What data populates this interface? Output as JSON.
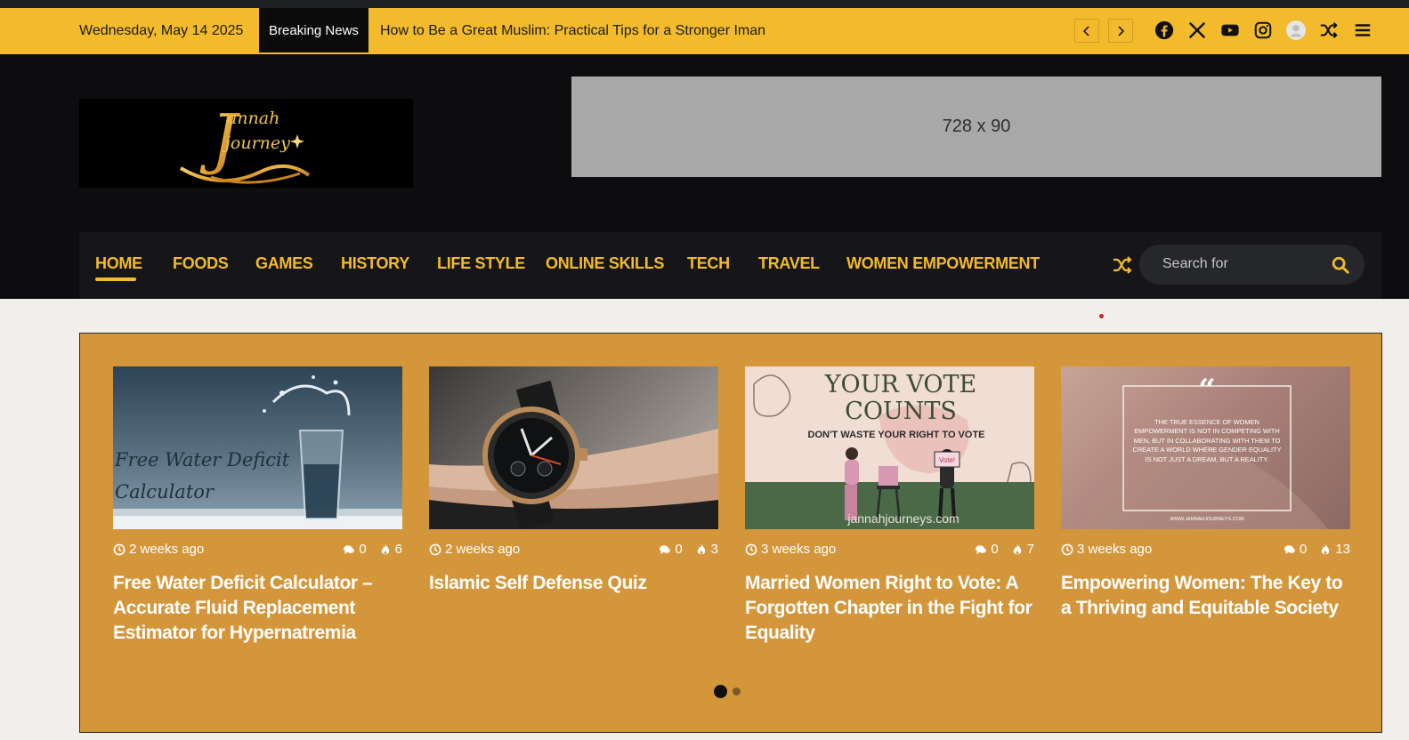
{
  "topbar": {
    "date": "Wednesday, May 14 2025",
    "breaking_label": "Breaking News",
    "breaking_title": "How to Be a Great Muslim: Practical Tips for a Stronger Iman",
    "icons": [
      "chevron-left-icon",
      "chevron-right-icon",
      "facebook-icon",
      "x-icon",
      "youtube-icon",
      "instagram-icon",
      "user-avatar-icon",
      "shuffle-icon",
      "menu-icon"
    ]
  },
  "header": {
    "logo_line1": "annah",
    "logo_line2": "journey",
    "logo_letter": "J",
    "ad_text": "728 x 90"
  },
  "nav": {
    "items": [
      {
        "label": "HOME",
        "active": true
      },
      {
        "label": "FOODS"
      },
      {
        "label": "GAMES"
      },
      {
        "label": "HISTORY"
      },
      {
        "label": "LIFE STYLE"
      },
      {
        "label": "ONLINE SKILLS"
      },
      {
        "label": "TECH"
      },
      {
        "label": "TRAVEL"
      },
      {
        "label": "WOMEN EMPOWERMENT"
      }
    ],
    "search_placeholder": "Search for"
  },
  "cards": [
    {
      "time": "2 weeks ago",
      "comments": "0",
      "views": "6",
      "title": "Free Water Deficit Calculator – Accurate Fluid Replacement Estimator for Hypernatremia",
      "thumb_text_1": "Free Water Deficit",
      "thumb_text_2": "Calculator"
    },
    {
      "time": "2 weeks ago",
      "comments": "0",
      "views": "3",
      "title": "Islamic Self Defense Quiz"
    },
    {
      "time": "3 weeks ago",
      "comments": "0",
      "views": "7",
      "title": "Married Women Right to Vote: A Forgotten Chapter in the Fight for Equality",
      "thumb_text_1": "YOUR VOTE",
      "thumb_text_2": "COUNTS",
      "thumb_text_3": "DON'T WASTE YOUR RIGHT TO VOTE",
      "thumb_text_4": "jannahjourneys.com",
      "thumb_text_5": "Vote!"
    },
    {
      "time": "3 weeks ago",
      "comments": "0",
      "views": "13",
      "title": "Empowering Women: The Key to a Thriving and Equitable Society",
      "thumb_text_1": "THE TRUE ESSENCE OF WOMEN EMPOWERMENT IS NOT IN COMPETING WITH MEN, BUT IN COLLABORATING WITH THEM TO CREATE A WORLD WHERE GENDER EQUALITY IS NOT JUST A DREAM, BUT A REALITY.",
      "thumb_text_2": "WWW.JANNAHJOURNEYS.COM"
    }
  ],
  "colors": {
    "accent": "#f3bb2b",
    "slider_bg": "#d4963b",
    "header_bg": "#0d0d0f"
  }
}
